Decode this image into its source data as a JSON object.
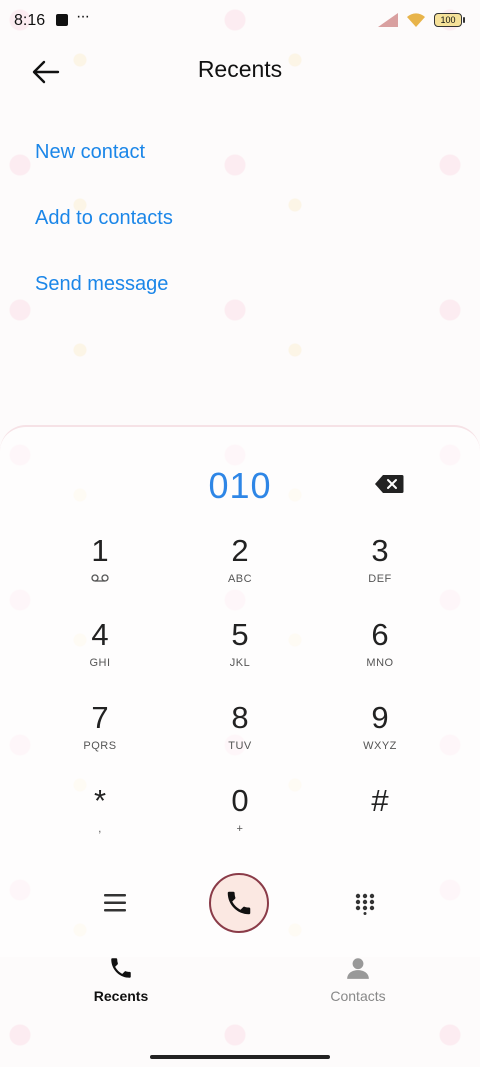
{
  "status_bar": {
    "time": "8:16",
    "more": "···",
    "battery": "100"
  },
  "header": {
    "title": "Recents"
  },
  "actions": [
    {
      "label": "New contact"
    },
    {
      "label": "Add to contacts"
    },
    {
      "label": "Send message"
    }
  ],
  "dialer": {
    "dialed_number": "010",
    "keys": [
      {
        "digit": "1",
        "letters": ""
      },
      {
        "digit": "2",
        "letters": "ABC"
      },
      {
        "digit": "3",
        "letters": "DEF"
      },
      {
        "digit": "4",
        "letters": "GHI"
      },
      {
        "digit": "5",
        "letters": "JKL"
      },
      {
        "digit": "6",
        "letters": "MNO"
      },
      {
        "digit": "7",
        "letters": "PQRS"
      },
      {
        "digit": "8",
        "letters": "TUV"
      },
      {
        "digit": "9",
        "letters": "WXYZ"
      },
      {
        "digit": "*",
        "letters": ","
      },
      {
        "digit": "0",
        "letters": "+"
      },
      {
        "digit": "#",
        "letters": ""
      }
    ]
  },
  "bottom_nav": {
    "recents": "Recents",
    "contacts": "Contacts"
  },
  "colors": {
    "accent": "#1b86e8",
    "dialed": "#2e86e6",
    "call_border": "#8a3b48",
    "call_bg": "#fbe8e2"
  },
  "icons": [
    "back-arrow",
    "backspace",
    "menu",
    "phone",
    "dialpad",
    "person",
    "voicemail"
  ]
}
